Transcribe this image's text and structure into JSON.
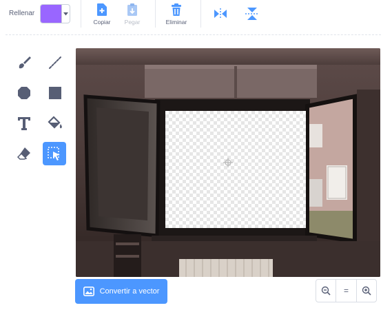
{
  "toolbar": {
    "fill_label": "Rellenar",
    "fill_color": "#9966ff",
    "copy_label": "Copiar",
    "paste_label": "Pegar",
    "delete_label": "Eliminar"
  },
  "tools": {
    "icons": [
      "brush-icon",
      "line-icon",
      "circle-icon",
      "rectangle-icon",
      "text-icon",
      "fill-bucket-icon",
      "eraser-icon",
      "select-icon"
    ],
    "active": "select-icon"
  },
  "canvas": {
    "image_description_icons": [
      "window-photo",
      "transparent-selection",
      "crosshair-icon"
    ]
  },
  "bottom": {
    "convert_label": "Convertir a vector",
    "zoom_reset_label": "="
  },
  "colors": {
    "accent": "#4c97ff",
    "fill": "#9966ff"
  }
}
